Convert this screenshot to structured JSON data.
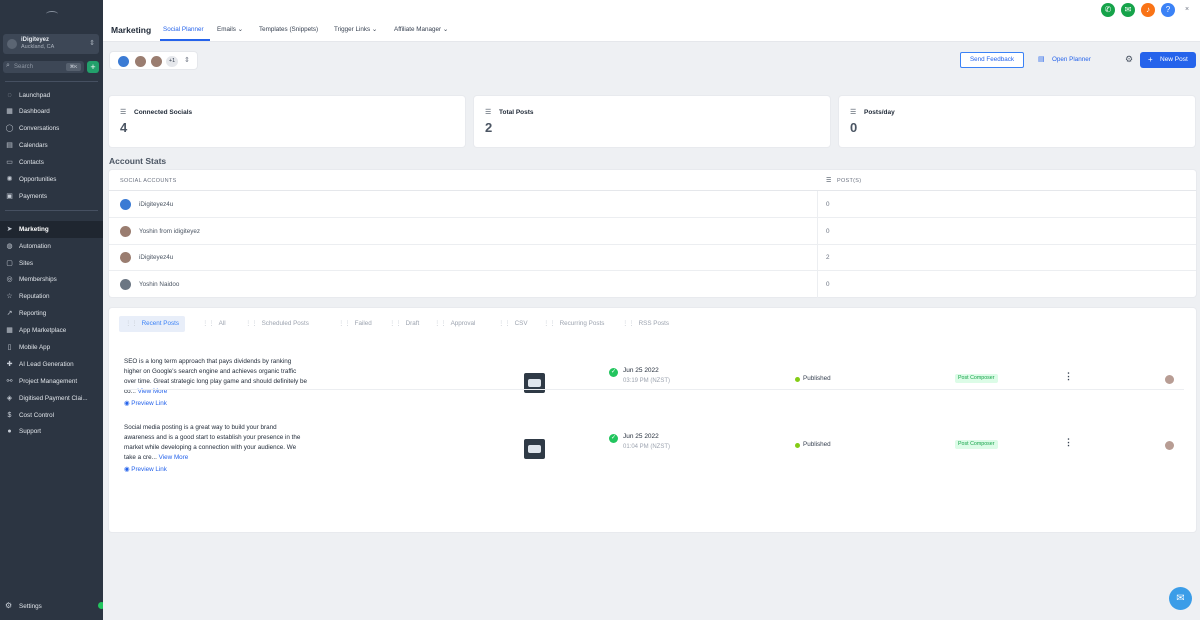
{
  "sidebar": {
    "account": {
      "name": "iDigiteyez",
      "location": "Auckland, CA"
    },
    "search": {
      "placeholder": "Search",
      "shortcut": "⌘K"
    },
    "items": [
      {
        "label": "Launchpad",
        "icon": "rocket-icon",
        "glyph": "◌"
      },
      {
        "label": "Dashboard",
        "icon": "dashboard-icon",
        "glyph": "▦"
      },
      {
        "label": "Conversations",
        "icon": "chat-icon",
        "glyph": "◯"
      },
      {
        "label": "Calendars",
        "icon": "calendar-icon",
        "glyph": "▤"
      },
      {
        "label": "Contacts",
        "icon": "contacts-icon",
        "glyph": "▭"
      },
      {
        "label": "Opportunities",
        "icon": "opportunities-icon",
        "glyph": "✺"
      },
      {
        "label": "Payments",
        "icon": "payments-icon",
        "glyph": "▣"
      },
      {
        "label": "Marketing",
        "icon": "send-icon",
        "glyph": "➤"
      },
      {
        "label": "Automation",
        "icon": "automation-icon",
        "glyph": "◍"
      },
      {
        "label": "Sites",
        "icon": "sites-icon",
        "glyph": "▢"
      },
      {
        "label": "Memberships",
        "icon": "memberships-icon",
        "glyph": "◎"
      },
      {
        "label": "Reputation",
        "icon": "star-icon",
        "glyph": "☆"
      },
      {
        "label": "Reporting",
        "icon": "reporting-icon",
        "glyph": "↗"
      },
      {
        "label": "App Marketplace",
        "icon": "marketplace-icon",
        "glyph": "▦"
      },
      {
        "label": "Mobile App",
        "icon": "mobile-icon",
        "glyph": "▯"
      },
      {
        "label": "AI Lead Generation",
        "icon": "ai-icon",
        "glyph": "✚"
      },
      {
        "label": "Project Management",
        "icon": "project-icon",
        "glyph": "⚯"
      },
      {
        "label": "Digitised Payment Clai...",
        "icon": "payment-claim-icon",
        "glyph": "◈"
      },
      {
        "label": "Cost Control",
        "icon": "dollar-icon",
        "glyph": "$"
      },
      {
        "label": "Support",
        "icon": "support-icon",
        "glyph": "●"
      }
    ],
    "settings_label": "Settings"
  },
  "header": {
    "title": "Marketing",
    "tabs": [
      {
        "label": "Social Planner"
      },
      {
        "label": "Emails ⌄"
      },
      {
        "label": "Templates (Snippets)"
      },
      {
        "label": "Trigger Links ⌄"
      },
      {
        "label": "Affiliate Manager ⌄"
      }
    ],
    "icons": [
      {
        "name": "phone-icon",
        "glyph": "✆",
        "color": "#16a34a"
      },
      {
        "name": "megaphone-icon",
        "glyph": "✉",
        "color": "#16a34a"
      },
      {
        "name": "bell-icon",
        "glyph": "♪",
        "color": "#f97316"
      },
      {
        "name": "help-icon",
        "glyph": "?",
        "color": "#3b82f6"
      }
    ]
  },
  "toolbar": {
    "more_count": "+1",
    "feedback_label": "Send Feedback",
    "planner_label": "Open Planner",
    "new_post_label": "New Post"
  },
  "stats": [
    {
      "label": "Connected Socials",
      "value": "4"
    },
    {
      "label": "Total Posts",
      "value": "2"
    },
    {
      "label": "Posts/day",
      "value": "0"
    }
  ],
  "account_stats": {
    "title": "Account Stats",
    "col_accounts": "SOCIAL ACCOUNTS",
    "col_posts": "POST(S)",
    "rows": [
      {
        "name": "iDigiteyez4u",
        "posts": "0",
        "avatar_color": "#3b7bd4"
      },
      {
        "name": "Yoshin from idigiteyez",
        "posts": "0",
        "avatar_color": "#9a7d70"
      },
      {
        "name": "iDigiteyez4u",
        "posts": "2",
        "avatar_color": "#9a7d70"
      },
      {
        "name": "Yoshin Naidoo",
        "posts": "0",
        "avatar_color": "#6b7683"
      }
    ]
  },
  "posts": {
    "tabs": [
      {
        "label": "Recent Posts"
      },
      {
        "label": "All"
      },
      {
        "label": "Scheduled Posts"
      },
      {
        "label": "Failed"
      },
      {
        "label": "Draft"
      },
      {
        "label": "Approval"
      },
      {
        "label": "CSV"
      },
      {
        "label": "Recurring Posts"
      },
      {
        "label": "RSS Posts"
      }
    ],
    "rows": [
      {
        "text": "SEO is a long term approach that pays dividends by ranking higher on Google's search engine and achieves organic traffic over time. Great strategic long play game and should definitely be co...",
        "view_more": "View More",
        "preview": "Preview Link",
        "date": "Jun 25 2022",
        "time": "03:19 PM (NZST)",
        "status": "Published",
        "source": "Post Composer"
      },
      {
        "text": "Social media posting is a great way to build your brand awareness and is a good start to establish your presence in the market while developing a connection with your audience. We take a cre...",
        "view_more": "View More",
        "preview": "Preview Link",
        "date": "Jun 25 2022",
        "time": "01:04 PM (NZST)",
        "status": "Published",
        "source": "Post Composer"
      }
    ]
  }
}
